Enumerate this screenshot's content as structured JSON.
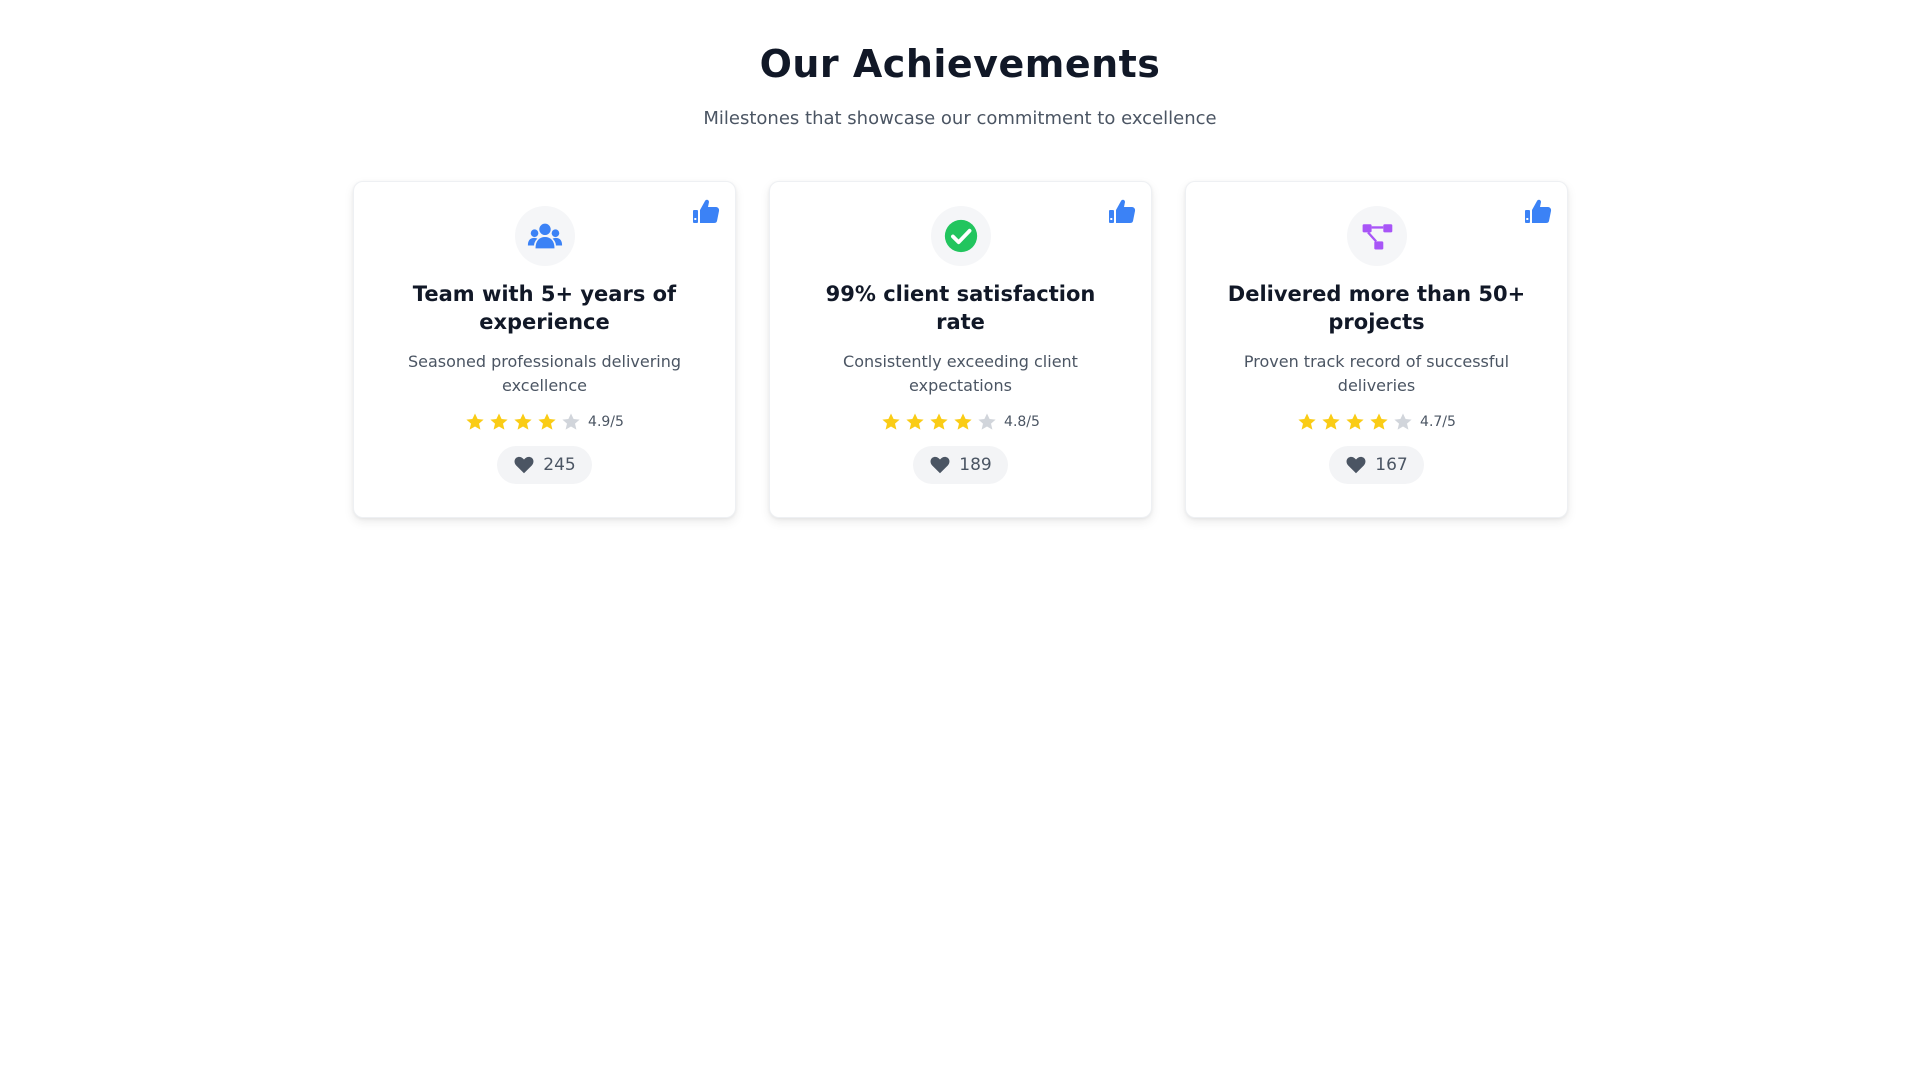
{
  "header": {
    "title": "Our Achievements",
    "subtitle": "Milestones that showcase our commitment to excellence"
  },
  "colors": {
    "star_filled": "#facc15",
    "star_empty": "#d1d5db",
    "thumb": "#3b82f6",
    "heart": "#4b5563"
  },
  "cards": [
    {
      "icon": "users-group-icon",
      "icon_color": "#3b82f6",
      "title": "Team with 5+ years of experience",
      "description": "Seasoned professionals delivering excellence",
      "stars_filled": 4,
      "stars_total": 5,
      "rating": "4.9/5",
      "likes": "245"
    },
    {
      "icon": "check-circle-icon",
      "icon_color": "#22c55e",
      "title": "99% client satisfaction rate",
      "description": "Consistently exceeding client expectations",
      "stars_filled": 4,
      "stars_total": 5,
      "rating": "4.8/5",
      "likes": "189"
    },
    {
      "icon": "project-diagram-icon",
      "icon_color": "#a855f7",
      "title": "Delivered more than 50+ projects",
      "description": "Proven track record of successful deliveries",
      "stars_filled": 4,
      "stars_total": 5,
      "rating": "4.7/5",
      "likes": "167"
    }
  ]
}
